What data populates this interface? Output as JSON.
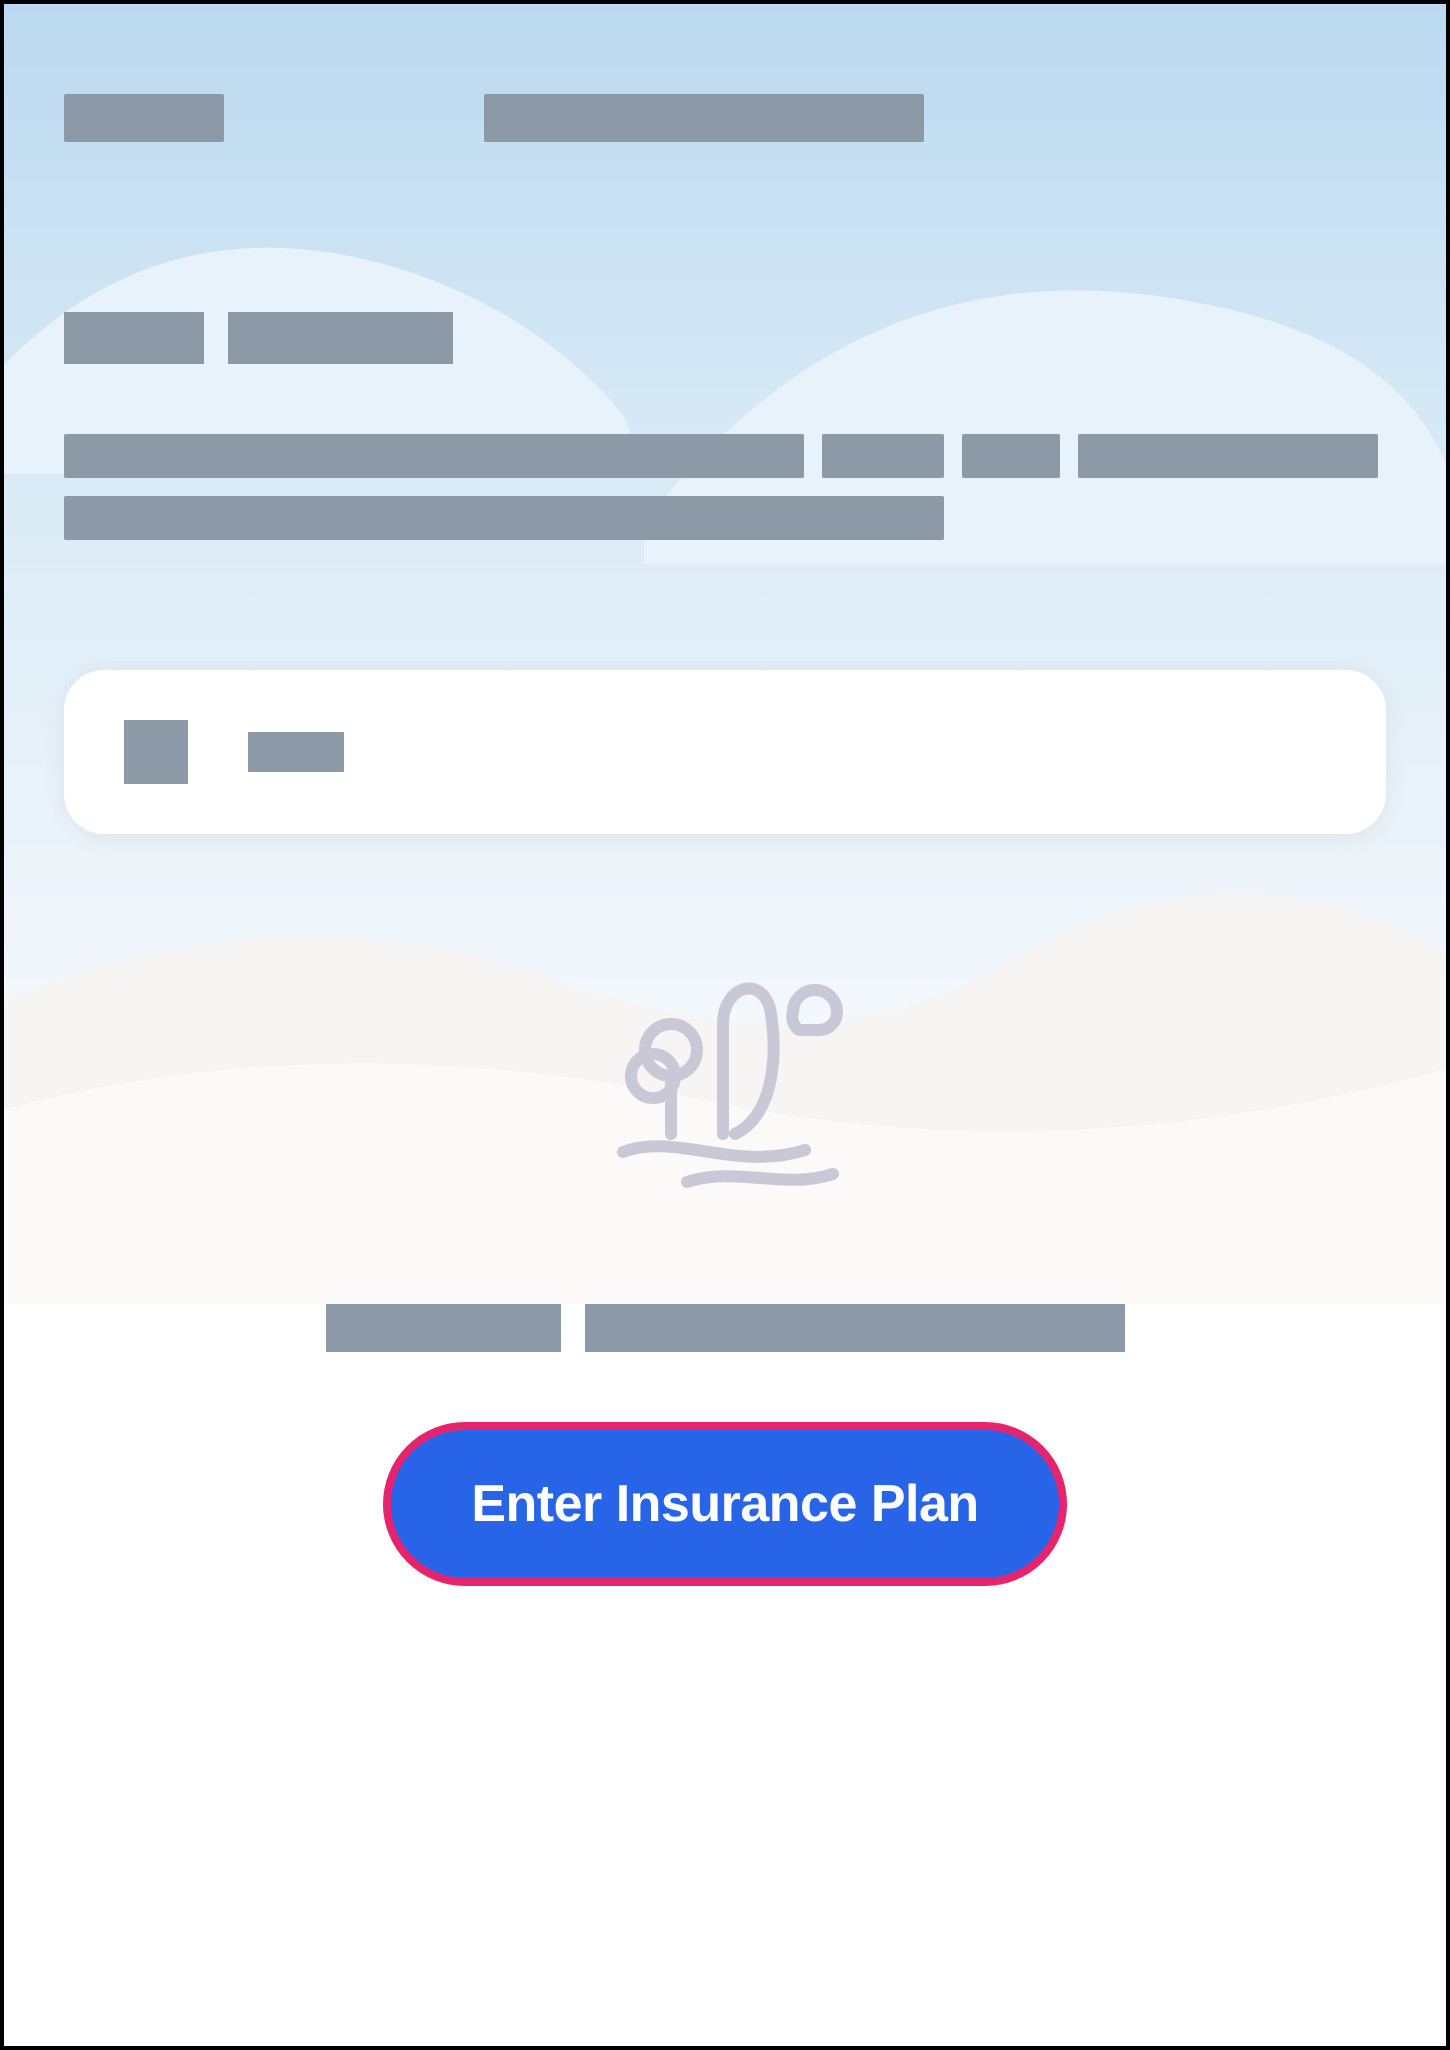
{
  "header": {
    "left_placeholder": "",
    "title_placeholder": ""
  },
  "greeting": {
    "part_a": "",
    "part_b": ""
  },
  "description": {
    "line1_a": "",
    "line1_b": "",
    "line1_c": "",
    "line1_d": "",
    "line2": ""
  },
  "card": {
    "icon": "card-icon",
    "label": ""
  },
  "empty_state": {
    "illustration": "trees-cloud-icon",
    "text_a": "",
    "text_b": ""
  },
  "cta": {
    "label": "Enter Insurance Plan"
  },
  "colors": {
    "placeholder": "#8C99A6",
    "button_bg": "#2864E8",
    "button_border": "#E6246E",
    "illustration_stroke": "#C9C8D6"
  }
}
